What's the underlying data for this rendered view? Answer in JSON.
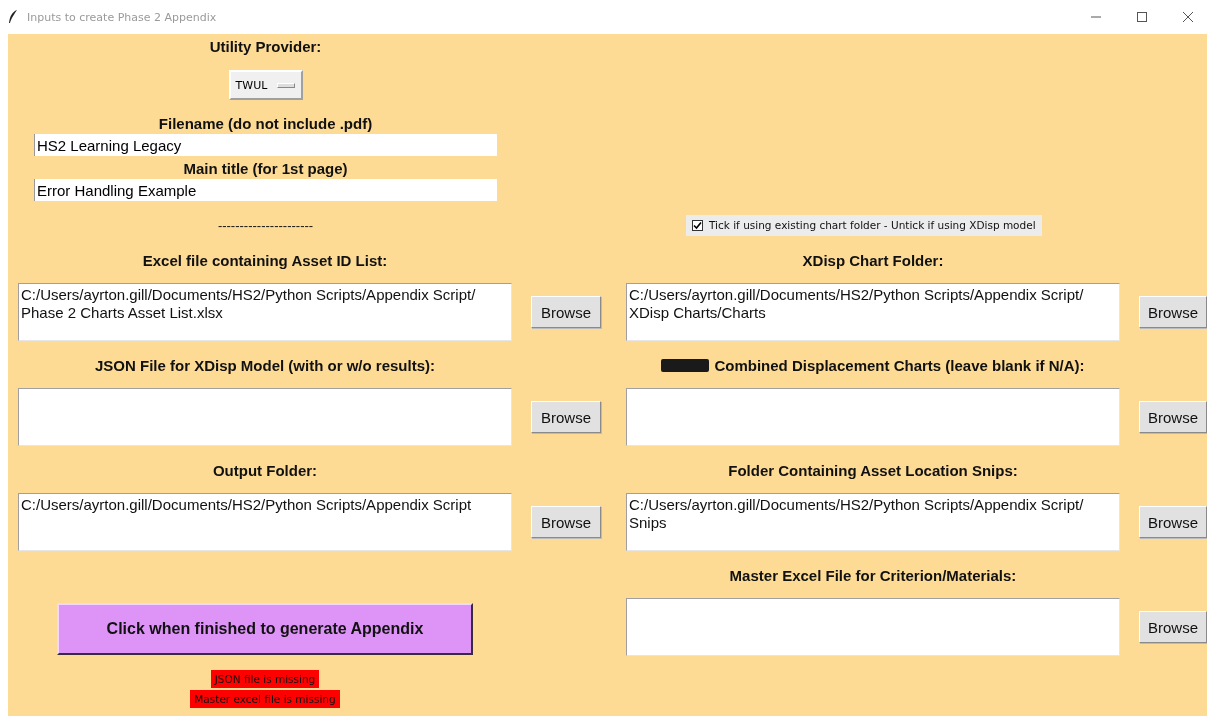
{
  "window": {
    "title": "Inputs to create Phase 2 Appendix"
  },
  "utility_provider": {
    "label": "Utility Provider:",
    "value": "TWUL"
  },
  "filename": {
    "label": "Filename (do not include .pdf)",
    "value": "HS2 Learning Legacy"
  },
  "main_title": {
    "label": "Main title (for 1st page)",
    "value": "Error Handling Example"
  },
  "separator": "----------------------",
  "existing_chart_folder": {
    "label": "Tick if using existing chart folder - Untick if using XDisp model",
    "checked": true
  },
  "left_fields": [
    {
      "label": "Excel file containing Asset ID List:",
      "value": "C:/Users/ayrton.gill/Documents/HS2/Python Scripts/Appendix Script/Phase 2 Charts Asset List.xlsx",
      "button": "Browse",
      "redacted": false
    },
    {
      "label": "JSON File for XDisp Model (with or w/o results):",
      "button": "Browse",
      "redacted": false
    },
    {
      "label": "Output Folder:",
      "value": "C:/Users/ayrton.gill/Documents/HS2/Python Scripts/Appendix Script",
      "button": "Browse",
      "redacted": false
    }
  ],
  "right_fields": [
    {
      "label": "XDisp Chart Folder:",
      "value": "C:/Users/ayrton.gill/Documents/HS2/Python Scripts/Appendix Script/XDisp Charts/Charts",
      "button": "Browse",
      "redacted": false
    },
    {
      "label": "Combined Displacement Charts (leave blank if N/A):",
      "button": "Browse",
      "redacted": true
    },
    {
      "label": "Folder Containing Asset Location Snips:",
      "value": "C:/Users/ayrton.gill/Documents/HS2/Python Scripts/Appendix Script/Snips",
      "button": "Browse",
      "redacted": false
    },
    {
      "label": "Master Excel File for Criterion/Materials:",
      "button": "Browse",
      "redacted": false
    }
  ],
  "generate_button": "Click when finished to generate Appendix",
  "errors": [
    "JSON file is missing",
    "Master excel file is missing"
  ]
}
